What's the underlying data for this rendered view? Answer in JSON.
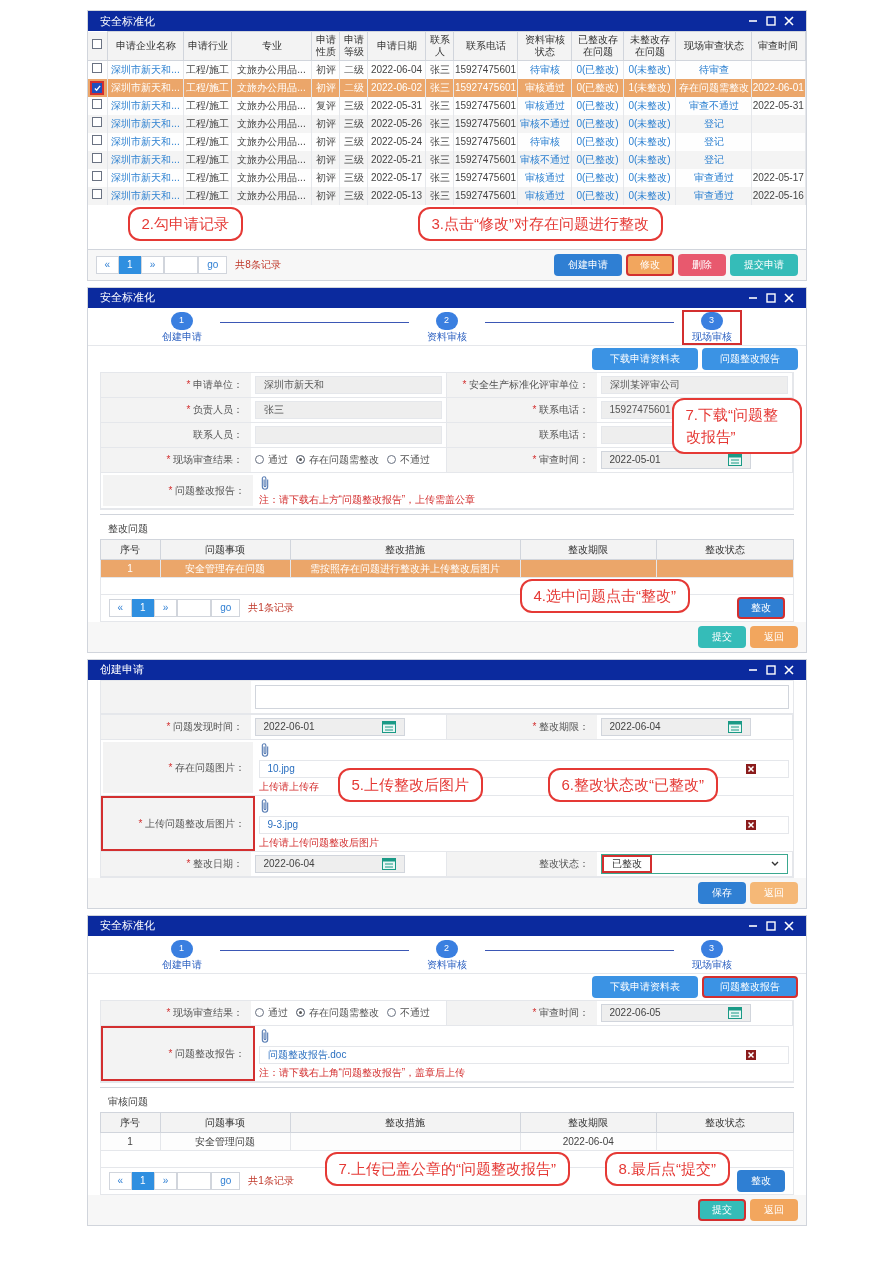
{
  "panels": [
    {
      "kind": "list",
      "title": "安全标准化",
      "select_all": {
        "checked": false
      },
      "columns": [
        "申请企业名称",
        "申请行业",
        "专业",
        "申请性质",
        "申请等级",
        "申请日期",
        "联系人",
        "联系电话",
        "资料审核状态",
        "已整改存在问题",
        "未整改存在问题",
        "现场审查状态",
        "审查时间"
      ],
      "rows": [
        {
          "checked": false,
          "selected": false,
          "cells": [
            "深圳市新天和...",
            "工程/施工",
            "文旅办公用品...",
            "初评",
            "二级",
            "2022-06-04",
            "张三",
            "15927475601",
            "待审核",
            "0(已整改)",
            "0(未整改)",
            "待审查",
            ""
          ]
        },
        {
          "checked": true,
          "selected": true,
          "cells": [
            "深圳市新天和...",
            "工程/施工",
            "文旅办公用品...",
            "初评",
            "二级",
            "2022-06-02",
            "张三",
            "15927475601",
            "审核通过",
            "0(已整改)",
            "1(未整改)",
            "存在问题需整改",
            "2022-06-01"
          ]
        },
        {
          "checked": false,
          "selected": false,
          "cells": [
            "深圳市新天和...",
            "工程/施工",
            "文旅办公用品...",
            "复评",
            "三级",
            "2022-05-31",
            "张三",
            "15927475601",
            "审核通过",
            "0(已整改)",
            "0(未整改)",
            "审查不通过",
            "2022-05-31"
          ]
        },
        {
          "checked": false,
          "selected": false,
          "cells": [
            "深圳市新天和...",
            "工程/施工",
            "文旅办公用品...",
            "初评",
            "三级",
            "2022-05-26",
            "张三",
            "15927475601",
            "审核不通过",
            "0(已整改)",
            "0(未整改)",
            "登记",
            ""
          ]
        },
        {
          "checked": false,
          "selected": false,
          "cells": [
            "深圳市新天和...",
            "工程/施工",
            "文旅办公用品...",
            "初评",
            "三级",
            "2022-05-24",
            "张三",
            "15927475601",
            "待审核",
            "0(已整改)",
            "0(未整改)",
            "登记",
            ""
          ]
        },
        {
          "checked": false,
          "selected": false,
          "cells": [
            "深圳市新天和...",
            "工程/施工",
            "文旅办公用品...",
            "初评",
            "三级",
            "2022-05-21",
            "张三",
            "15927475601",
            "审核不通过",
            "0(已整改)",
            "0(未整改)",
            "登记",
            ""
          ]
        },
        {
          "checked": false,
          "selected": false,
          "cells": [
            "深圳市新天和...",
            "工程/施工",
            "文旅办公用品...",
            "初评",
            "三级",
            "2022-05-17",
            "张三",
            "15927475601",
            "审核通过",
            "0(已整改)",
            "0(未整改)",
            "审查通过",
            "2022-05-17"
          ]
        },
        {
          "checked": false,
          "selected": false,
          "cells": [
            "深圳市新天和...",
            "工程/施工",
            "文旅办公用品...",
            "初评",
            "三级",
            "2022-05-13",
            "张三",
            "15927475601",
            "审核通过",
            "0(已整改)",
            "0(未整改)",
            "审查通过",
            "2022-05-16"
          ]
        }
      ],
      "pager": {
        "prev": "«",
        "page": "1",
        "next": "»",
        "go": "go",
        "total": "共8条记录"
      },
      "buttons": [
        {
          "label": "创建申请",
          "color": "#2f7fd3",
          "annotated": false
        },
        {
          "label": "修改",
          "color": "#f2a65e",
          "annotated": true
        },
        {
          "label": "删除",
          "color": "#e8596e",
          "annotated": false
        },
        {
          "label": "提交申请",
          "color": "#35bcb8",
          "annotated": false
        }
      ],
      "callouts": [
        "2.勾申请记录",
        "3.点击“修改”对存在问题进行整改"
      ]
    },
    {
      "kind": "review",
      "title": "安全标准化",
      "steps": [
        {
          "number": "1",
          "label": "创建申请",
          "annotated": false
        },
        {
          "number": "2",
          "label": "资料审核",
          "annotated": false
        },
        {
          "number": "3",
          "label": "现场审核",
          "annotated": true
        }
      ],
      "actions": [
        {
          "label": "下载申请资料表",
          "annotated": false
        },
        {
          "label": "问题整改报告",
          "annotated": false
        }
      ],
      "form": [
        [
          {
            "kind": "text",
            "mark": "*",
            "label": "申请单位：",
            "value": "深圳市新天和"
          },
          {
            "kind": "text",
            "mark": "*",
            "label": "安全生产标准化评审单位：",
            "value": "深圳某评审公司"
          }
        ],
        [
          {
            "kind": "text",
            "mark": "*",
            "label": "负责人员：",
            "value": "张三"
          },
          {
            "kind": "text",
            "mark": "*",
            "label": "联系电话：",
            "value": "15927475601"
          }
        ],
        [
          {
            "kind": "text",
            "label": "联系人员："
          },
          {
            "kind": "text",
            "label": "联系电话："
          }
        ],
        [
          {
            "kind": "radios",
            "mark": "*",
            "label": "现场审查结果：",
            "options": [
              {
                "label": "通过",
                "selected": false
              },
              {
                "label": "存在问题需整改",
                "selected": true
              },
              {
                "label": "不通过",
                "selected": false
              }
            ]
          },
          {
            "kind": "date",
            "mark": "*",
            "label": "审查时间：",
            "value": "2022-05-01"
          }
        ],
        [
          {
            "kind": "upload",
            "mark": "*",
            "label": "问题整改报告：",
            "annotated": false,
            "note": "注：请下载右上方“问题整改报告”，上传需盖公章"
          }
        ]
      ],
      "section": "整改问题",
      "columns": [
        "序号",
        "问题事项",
        "整改措施",
        "整改期限",
        "整改状态"
      ],
      "rows": [
        {
          "selected": true,
          "cells": [
            "1",
            "安全管理存在问题",
            "需按照存在问题进行整改并上传整改后图片"
          ]
        }
      ],
      "pager": {
        "prev": "«",
        "page": "1",
        "next": "»",
        "go": "go",
        "total": "共1条记录"
      },
      "table_button": {
        "label": "整改",
        "annotated": true
      },
      "buttons": [
        {
          "label": "提交",
          "color": "#35bcb8",
          "annotated": false
        },
        {
          "label": "返回",
          "color": "#f2a65e",
          "annotated": false
        }
      ],
      "callouts": [
        "7.下载“问题整改报告”",
        "4.选中问题点击“整改”"
      ]
    },
    {
      "kind": "edit",
      "title": "创建申请",
      "form": [
        [
          {
            "kind": "date",
            "mark": "*",
            "label": "问题发现时间：",
            "value": "2022-06-01"
          },
          {
            "kind": "date",
            "mark": "*",
            "label": "整改期限：",
            "value": "2022-06-04"
          }
        ],
        [
          {
            "kind": "upload",
            "mark": "*",
            "label": "存在问题图片：",
            "annotated": false,
            "file": "10.jpg",
            "note": "上传请上传存"
          }
        ],
        [
          {
            "kind": "upload",
            "mark": "*",
            "label": "上传问题整改后图片：",
            "annotated": true,
            "file": "9-3.jpg",
            "note": "上传请上传问题整改后图片"
          }
        ],
        [
          {
            "kind": "date",
            "mark": "*",
            "label": "整改日期：",
            "value": "2022-06-04"
          },
          {
            "kind": "select",
            "label": "整改状态：",
            "value": "已整改",
            "annotated": true
          }
        ]
      ],
      "buttons": [
        {
          "label": "保存",
          "color": "#2f7fd3",
          "annotated": false
        },
        {
          "label": "返回",
          "color": "#f5b877",
          "annotated": false
        }
      ],
      "callouts": [
        "5.上传整改后图片",
        "6.整改状态改“已整改”"
      ]
    },
    {
      "kind": "review",
      "title": "安全标准化",
      "steps": [
        {
          "number": "1",
          "label": "创建申请",
          "annotated": false
        },
        {
          "number": "2",
          "label": "资料审核",
          "annotated": false
        },
        {
          "number": "3",
          "label": "现场审核",
          "annotated": false
        }
      ],
      "actions": [
        {
          "label": "下载申请资料表",
          "annotated": false
        },
        {
          "label": "问题整改报告",
          "annotated": true
        }
      ],
      "form": [
        [
          {
            "kind": "radios",
            "mark": "*",
            "label": "现场审查结果：",
            "options": [
              {
                "label": "通过",
                "selected": false
              },
              {
                "label": "存在问题需整改",
                "selected": true
              },
              {
                "label": "不通过",
                "selected": false
              }
            ]
          },
          {
            "kind": "date",
            "mark": "*",
            "label": "审查时间：",
            "value": "2022-06-05"
          }
        ],
        [
          {
            "kind": "upload",
            "mark": "*",
            "label": "问题整改报告：",
            "annotated": true,
            "file": "问题整改报告.doc",
            "note": "注：请下载右上角“问题整改报告”，盖章后上传"
          }
        ]
      ],
      "section": "审核问题",
      "columns": [
        "序号",
        "问题事项",
        "整改措施",
        "整改期限",
        "整改状态"
      ],
      "rows": [
        {
          "selected": false,
          "cells": [
            "1",
            "安全管理问题",
            "",
            "2022-06-04"
          ]
        }
      ],
      "pager": {
        "prev": "«",
        "page": "1",
        "next": "»",
        "go": "go",
        "total": "共1条记录"
      },
      "table_button": {
        "label": "整改",
        "annotated": false
      },
      "buttons": [
        {
          "label": "提交",
          "color": "#35bcb8",
          "annotated": true
        },
        {
          "label": "返回",
          "color": "#f2a65e",
          "annotated": false
        }
      ],
      "callouts": [
        "7.上传已盖公章的“问题整改报告”",
        "8.最后点“提交”"
      ]
    }
  ]
}
